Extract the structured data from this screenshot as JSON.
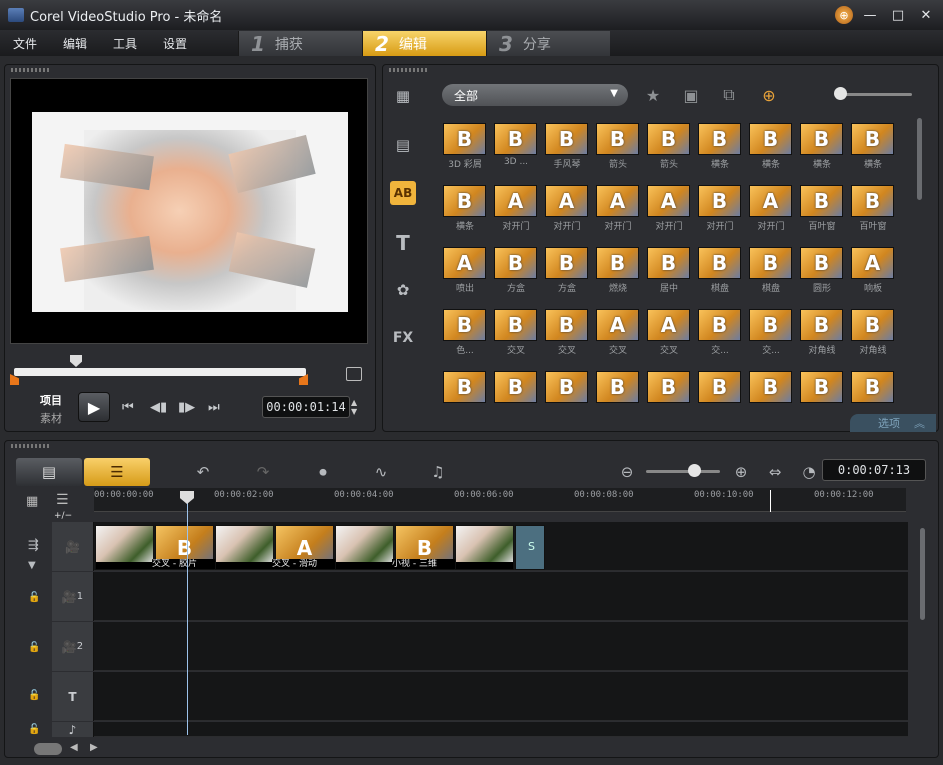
{
  "window": {
    "title": "Corel VideoStudio Pro - 未命名",
    "help_label": "⊕",
    "minimize": "—",
    "maximize": "□",
    "close": "✕"
  },
  "menu": [
    "文件",
    "编辑",
    "工具",
    "设置"
  ],
  "steps": [
    {
      "num": "1",
      "label": "捕获"
    },
    {
      "num": "2",
      "label": "编辑"
    },
    {
      "num": "3",
      "label": "分享"
    }
  ],
  "player": {
    "mode_project": "项目",
    "mode_clip": "素材",
    "timecode": "00:00:01:14"
  },
  "library": {
    "filter": "全部",
    "tabs": [
      "media-icon",
      "instant-project-icon",
      "transition-icon",
      "title-icon",
      "graphic-icon",
      "filter-icon"
    ],
    "tab_fx": "FX",
    "tab_ab": "AB",
    "tab_t": "T",
    "options_label": "选项",
    "items": [
      {
        "letter": "B",
        "label": "3D 彩屑"
      },
      {
        "letter": "B",
        "label": "3D ..."
      },
      {
        "letter": "B",
        "label": "手风琴"
      },
      {
        "letter": "B",
        "label": "箭头"
      },
      {
        "letter": "B",
        "label": "箭头"
      },
      {
        "letter": "B",
        "label": "横条"
      },
      {
        "letter": "B",
        "label": "横条"
      },
      {
        "letter": "B",
        "label": "横条"
      },
      {
        "letter": "B",
        "label": "横条"
      },
      {
        "letter": "B",
        "label": "横条"
      },
      {
        "letter": "A",
        "label": "对开门"
      },
      {
        "letter": "A",
        "label": "对开门"
      },
      {
        "letter": "A",
        "label": "对开门"
      },
      {
        "letter": "A",
        "label": "对开门"
      },
      {
        "letter": "B",
        "label": "对开门"
      },
      {
        "letter": "A",
        "label": "对开门"
      },
      {
        "letter": "B",
        "label": "百叶窗"
      },
      {
        "letter": "B",
        "label": "百叶窗"
      },
      {
        "letter": "A",
        "label": "喷出"
      },
      {
        "letter": "B",
        "label": "方盒"
      },
      {
        "letter": "B",
        "label": "方盒"
      },
      {
        "letter": "B",
        "label": "燃烧"
      },
      {
        "letter": "B",
        "label": "居中"
      },
      {
        "letter": "B",
        "label": "棋盘"
      },
      {
        "letter": "B",
        "label": "棋盘"
      },
      {
        "letter": "B",
        "label": "圆形"
      },
      {
        "letter": "A",
        "label": "响板"
      },
      {
        "letter": "B",
        "label": "色..."
      },
      {
        "letter": "B",
        "label": "交叉"
      },
      {
        "letter": "B",
        "label": "交叉"
      },
      {
        "letter": "A",
        "label": "交叉"
      },
      {
        "letter": "A",
        "label": "交叉"
      },
      {
        "letter": "B",
        "label": "交..."
      },
      {
        "letter": "B",
        "label": "交..."
      },
      {
        "letter": "B",
        "label": "对角线"
      },
      {
        "letter": "B",
        "label": "对角线"
      },
      {
        "letter": "B",
        "label": ""
      },
      {
        "letter": "B",
        "label": ""
      },
      {
        "letter": "B",
        "label": ""
      },
      {
        "letter": "B",
        "label": ""
      },
      {
        "letter": "B",
        "label": ""
      },
      {
        "letter": "B",
        "label": ""
      },
      {
        "letter": "B",
        "label": ""
      },
      {
        "letter": "B",
        "label": ""
      },
      {
        "letter": "B",
        "label": ""
      }
    ]
  },
  "timeline": {
    "timecode": "0:00:07:13",
    "add_remove": "+/−",
    "ruler": [
      "00:00:00:00",
      "00:00:02:00",
      "00:00:04:00",
      "00:00:06:00",
      "00:00:08:00",
      "00:00:10:00",
      "00:00:12:00"
    ],
    "clips": [
      {
        "type": "video",
        "caption": ""
      },
      {
        "type": "transition",
        "letter": "B",
        "caption": "交叉 - 胶片"
      },
      {
        "type": "video",
        "caption": ""
      },
      {
        "type": "transition",
        "letter": "A",
        "caption": "交叉 - 滑动"
      },
      {
        "type": "video",
        "caption": ""
      },
      {
        "type": "transition",
        "letter": "B",
        "caption": "小视 - 三维"
      },
      {
        "type": "video",
        "caption": ""
      },
      {
        "type": "color",
        "caption": "S"
      }
    ],
    "track_numbers": [
      "1",
      "2"
    ]
  }
}
